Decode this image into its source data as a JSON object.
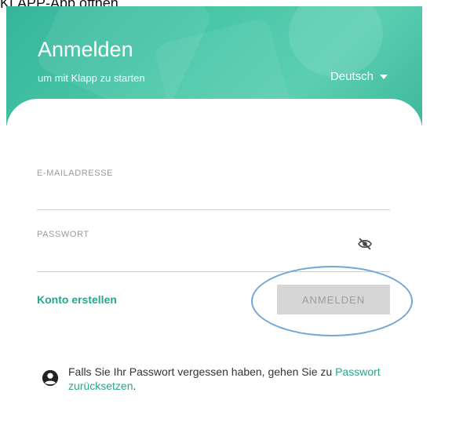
{
  "caption": "KLAPP-App öffnen",
  "header": {
    "title": "Anmelden",
    "subtitle": "um mit Klapp zu starten",
    "language": "Deutsch"
  },
  "form": {
    "email": {
      "label": "E-MAILADRESSE",
      "value": ""
    },
    "password": {
      "label": "PASSWORT",
      "value": "",
      "toggle_icon": "eye-off-icon"
    },
    "create_account": "Konto erstellen",
    "login_button": "ANMELDEN"
  },
  "info": {
    "icon": "user-circle-icon",
    "text_before": "Falls Sie Ihr Passwort vergessen haben, gehen Sie zu ",
    "link": "Passwort zurücksetzen",
    "text_after": "."
  },
  "colors": {
    "accent": "#2aa58a",
    "header": "#48c6a6",
    "button_disabled": "#d6d6d6",
    "highlight": "#6fa7d8"
  }
}
